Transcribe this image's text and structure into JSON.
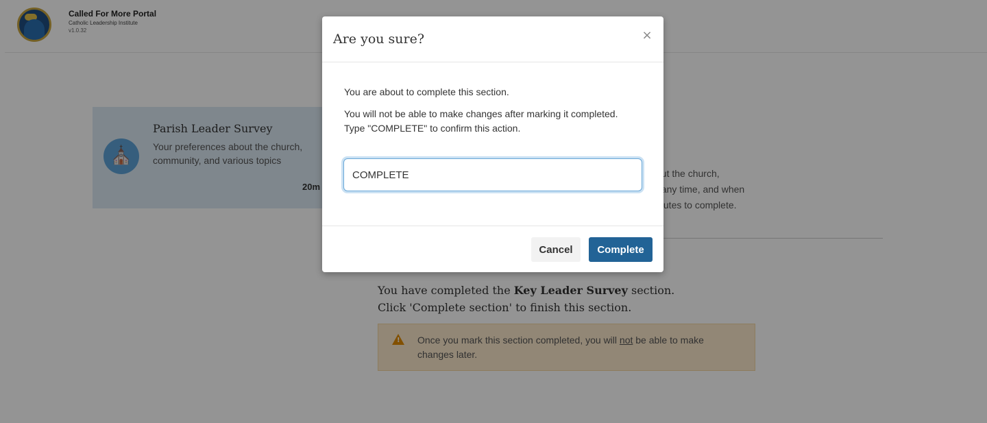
{
  "header": {
    "title": "Called For More Portal",
    "subtitle": "Catholic Leadership Institute",
    "version": "v1.0.32"
  },
  "survey_card": {
    "title": "Parish Leader Survey",
    "description": "Your preferences about the church, community, and various topics",
    "time": "20m",
    "icon": "church-icon"
  },
  "side_text": {
    "line1": "out the church,",
    "line2": "t any time, and when",
    "line3": "inutes to complete."
  },
  "completion": {
    "prefix": "You have completed the",
    "section_name": "Key Leader Survey",
    "suffix": "section.",
    "instruction": "Click 'Complete section' to finish this section."
  },
  "warning": {
    "before": "Once you mark this section completed, you will",
    "emphasis": "not",
    "after": "be able to make changes later."
  },
  "modal": {
    "title": "Are you sure?",
    "close_symbol": "×",
    "message1": "You are about to complete this section.",
    "message2": "You will not be able to make changes after marking it completed.",
    "message3": "Type \"COMPLETE\" to confirm this action.",
    "input_value": "COMPLETE",
    "cancel_label": "Cancel",
    "confirm_label": "Complete"
  },
  "colors": {
    "primary_button": "#226396",
    "card_background": "#dbe8f3",
    "warning_background": "#fbe9cc",
    "warning_icon": "#e08a00"
  }
}
